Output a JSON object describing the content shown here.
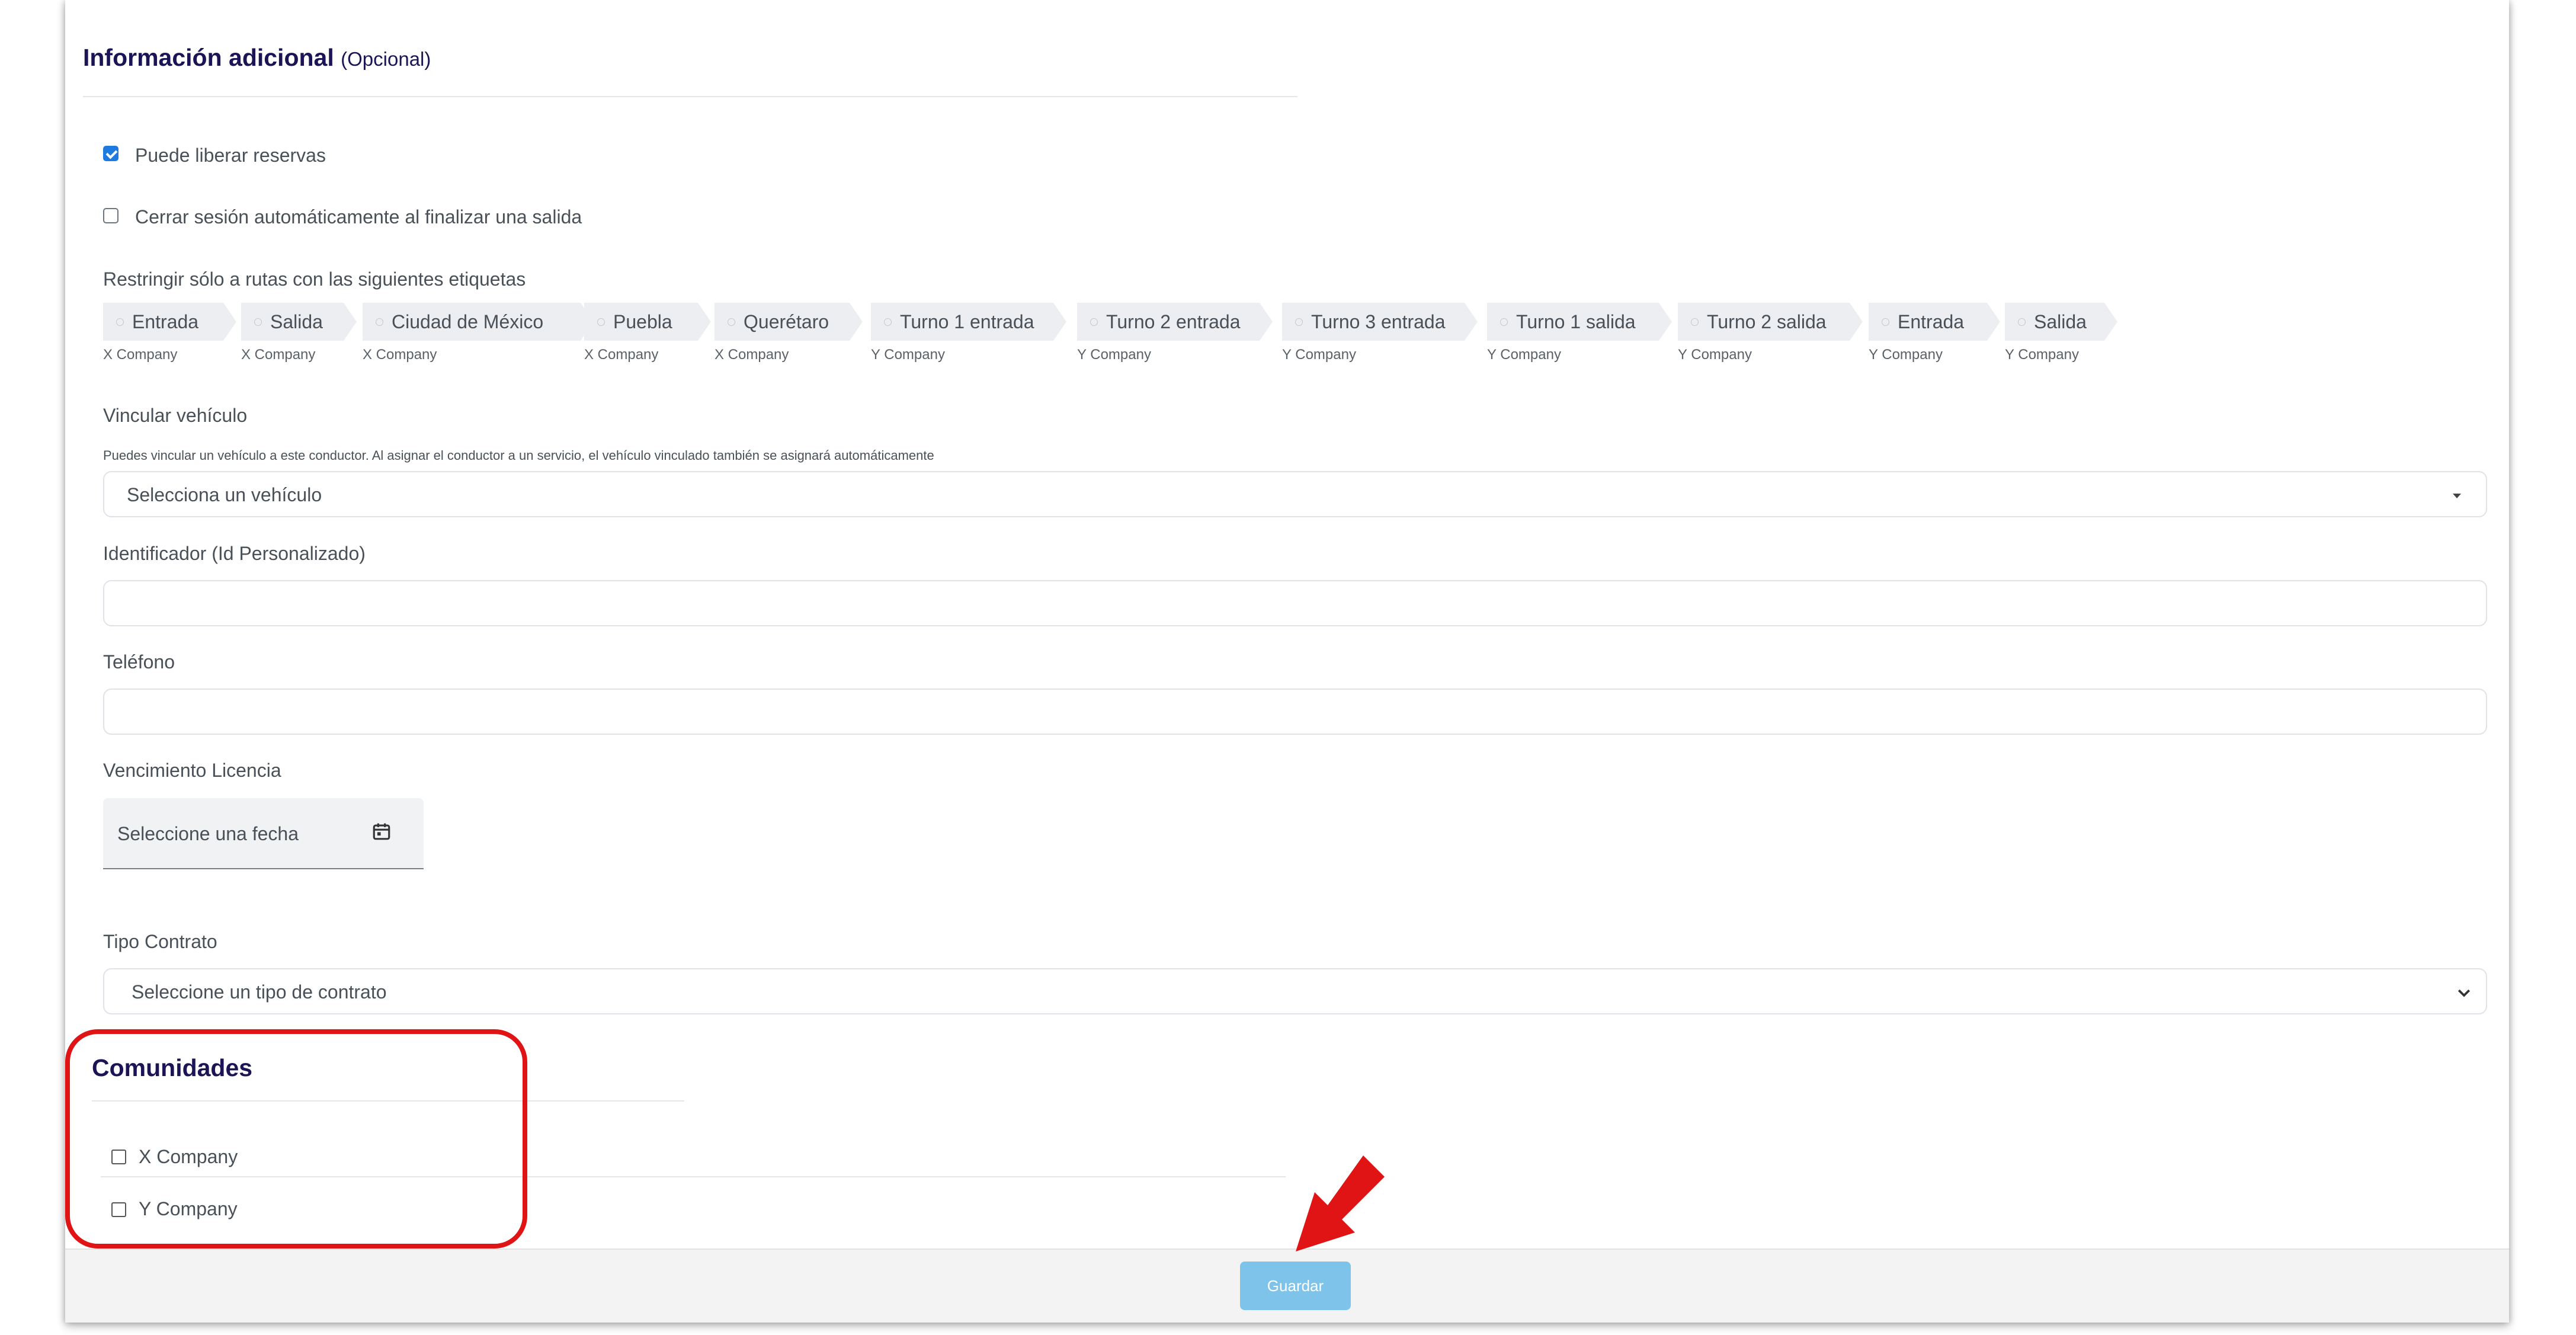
{
  "section_title": "Información adicional",
  "section_optional": "(Opcional)",
  "checkbox_release": {
    "label": "Puede liberar reservas",
    "checked": true
  },
  "checkbox_logout": {
    "label": "Cerrar sesión automáticamente al finalizar una salida",
    "checked": false
  },
  "restrict_label": "Restringir sólo a rutas con las siguientes etiquetas",
  "tags": [
    {
      "label": "Entrada",
      "company": "X Company"
    },
    {
      "label": "Salida",
      "company": "X Company"
    },
    {
      "label": "Ciudad de México",
      "company": "X Company"
    },
    {
      "label": "Puebla",
      "company": "X Company"
    },
    {
      "label": "Querétaro",
      "company": "X Company"
    },
    {
      "label": "Turno 1 entrada",
      "company": "Y Company"
    },
    {
      "label": "Turno 2 entrada",
      "company": "Y Company"
    },
    {
      "label": "Turno 3 entrada",
      "company": "Y Company"
    },
    {
      "label": "Turno 1 salida",
      "company": "Y Company"
    },
    {
      "label": "Turno 2 salida",
      "company": "Y Company"
    },
    {
      "label": "Entrada",
      "company": "Y Company"
    },
    {
      "label": "Salida",
      "company": "Y Company"
    }
  ],
  "vehicle": {
    "label": "Vincular vehículo",
    "help": "Puedes vincular un vehículo a este conductor. Al asignar el conductor a un servicio, el vehículo vinculado también se asignará automáticamente",
    "placeholder": "Selecciona un vehículo"
  },
  "identifier": {
    "label": "Identificador (Id Personalizado)",
    "value": ""
  },
  "phone": {
    "label": "Teléfono",
    "value": ""
  },
  "license": {
    "label": "Vencimiento Licencia",
    "placeholder": "Seleccione una fecha",
    "icon": "calendar-icon"
  },
  "contract": {
    "label": "Tipo Contrato",
    "placeholder": "Seleccione un tipo de contrato"
  },
  "communities": {
    "title": "Comunidades",
    "items": [
      {
        "label": "X Company",
        "checked": false
      },
      {
        "label": "Y Company",
        "checked": false
      }
    ]
  },
  "save_label": "Guardar",
  "annotation_color": "#e01414",
  "accent_color": "#1f7ae0",
  "button_color": "#7ec3ea"
}
